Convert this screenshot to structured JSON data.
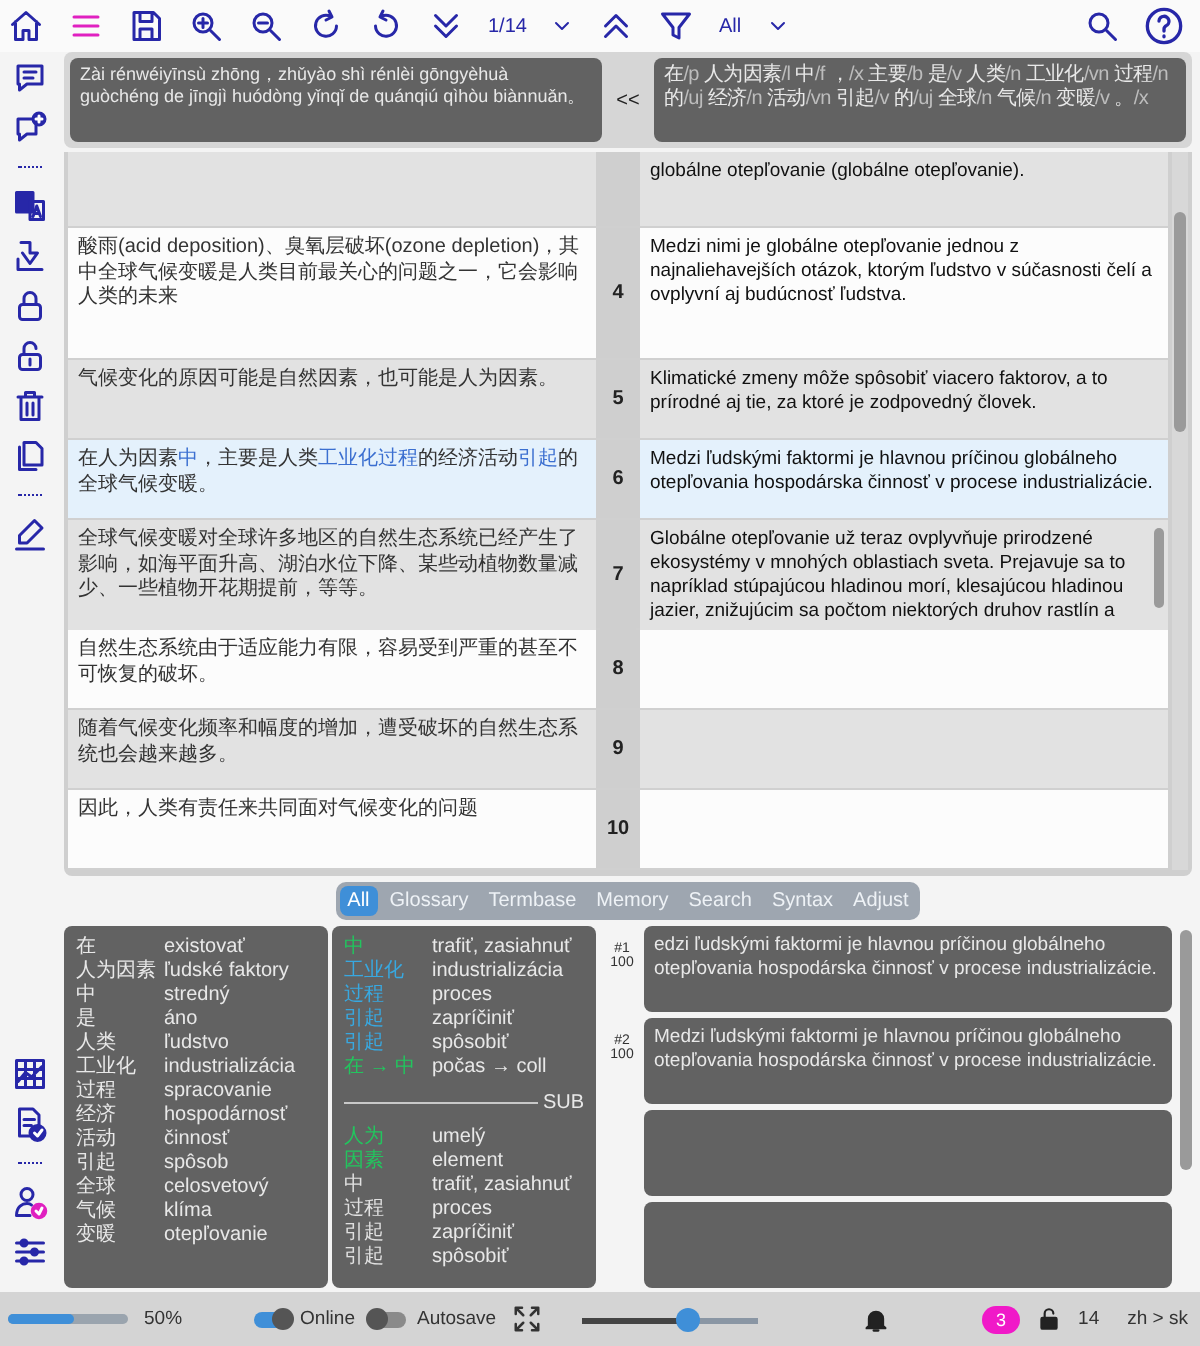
{
  "toolbar": {
    "page": "1/14",
    "filter": "All"
  },
  "pinyin": "Zài rénwéiyīnsù zhōng，zhǔyào shì rénlèi gōngyèhuà guòchéng de jīngjì huódòng yǐnqǐ de quánqiú qìhòu biànnuǎn。",
  "copy_button": "<<",
  "tagged_tokens": [
    {
      "word": "在",
      "tag": "/p"
    },
    {
      "word": "人为因素",
      "tag": "/l"
    },
    {
      "word": "中",
      "tag": "/f"
    },
    {
      "word": "，",
      "tag": "/x"
    },
    {
      "word": "主要",
      "tag": "/b"
    },
    {
      "word": "是",
      "tag": "/v"
    },
    {
      "word": "人类",
      "tag": "/n"
    },
    {
      "word": "工业化",
      "tag": "/vn"
    },
    {
      "word": "过程",
      "tag": "/n"
    },
    {
      "word": "的",
      "tag": "/uj"
    },
    {
      "word": "经济",
      "tag": "/n"
    },
    {
      "word": "活动",
      "tag": "/vn"
    },
    {
      "word": "引起",
      "tag": "/v"
    },
    {
      "word": "的",
      "tag": "/uj"
    },
    {
      "word": "全球",
      "tag": "/n"
    },
    {
      "word": "气候",
      "tag": "/n"
    },
    {
      "word": "变暖",
      "tag": "/v"
    },
    {
      "word": "。",
      "tag": "/x"
    }
  ],
  "rows": [
    {
      "target": "globálne otepľovanie (globálne otepľovanie).",
      "selected": false
    },
    {
      "number": "4",
      "source": "酸雨(acid deposition)、臭氧层破坏(ozone depletion)，其中全球气候变暖是人类目前最关心的问题之一，它会影响人类的未来",
      "target": "Medzi nimi je globálne otepľovanie jednou z najnaliehavejších otázok, ktorým ľudstvo v súčasnosti čelí a ovplyvní aj budúcnosť ľudstva.",
      "selected": false
    },
    {
      "number": "5",
      "source": "气候变化的原因可能是自然因素，也可能是人为因素。",
      "target": "Klimatické zmeny môže spôsobiť viacero faktorov, a to prírodné aj tie, za ktoré je zodpovedný človek.",
      "selected": false
    },
    {
      "number": "6",
      "source_parts": [
        {
          "text": "在人为因素",
          "highlight": false
        },
        {
          "text": "中",
          "highlight": true
        },
        {
          "text": "，主要是人类",
          "highlight": false
        },
        {
          "text": "工业化过程",
          "highlight": true
        },
        {
          "text": "的经济活动",
          "highlight": false
        },
        {
          "text": "引起",
          "highlight": true
        },
        {
          "text": "的全球气候变暖。",
          "highlight": false
        }
      ],
      "target": "Medzi ľudskými faktormi je hlavnou príčinou globálneho otepľovania hospodárska činnosť v procese industrializácie.",
      "selected": true
    },
    {
      "number": "7",
      "source": "全球气候变暖对全球许多地区的自然生态系统已经产生了影响，如海平面升高、湖泊水位下降、某些动植物数量减少、一些植物开花期提前，等等。",
      "target": "Globálne otepľovanie už teraz ovplyvňuje prirodzené ekosystémy v mnohých oblastiach sveta. Prejavuje sa to napríklad stúpajúcou hladinou morí, klesajúcou hladinou jazier, znižujúcim sa počtom niektorých druhov rastlín a",
      "selected": false
    },
    {
      "number": "8",
      "source": "自然生态系统由于适应能力有限，容易受到严重的甚至不可恢复的破坏。",
      "selected": false
    },
    {
      "number": "9",
      "source": "随着气候变化频率和幅度的增加，遭受破坏的自然生态系统也会越来越多。",
      "selected": false
    },
    {
      "number": "10",
      "source": "因此，人类有责任来共同面对气候变化的问题",
      "selected": false
    }
  ],
  "tabs": [
    {
      "label": "All",
      "selected": true
    },
    {
      "label": "Glossary",
      "selected": false
    },
    {
      "label": "Termbase",
      "selected": false
    },
    {
      "label": "Memory",
      "selected": false
    },
    {
      "label": "Search",
      "selected": false
    },
    {
      "label": "Syntax",
      "selected": false
    },
    {
      "label": "Adjust",
      "selected": false
    }
  ],
  "glossary": [
    {
      "term": "在",
      "translation": "existovať"
    },
    {
      "term": "人为因素",
      "translation": "ľudské faktory"
    },
    {
      "term": "中",
      "translation": "stredný"
    },
    {
      "term": "是",
      "translation": "áno"
    },
    {
      "term": "人类",
      "translation": "ľudstvo"
    },
    {
      "term": "工业化",
      "translation": "industrializácia"
    },
    {
      "term": "过程",
      "translation": "spracovanie"
    },
    {
      "term": "经济",
      "translation": "hospodárnosť"
    },
    {
      "term": "活动",
      "translation": "činnosť"
    },
    {
      "term": "引起",
      "translation": "spôsob"
    },
    {
      "term": "全球",
      "translation": "celosvetový"
    },
    {
      "term": "气候",
      "translation": "klíma"
    },
    {
      "term": "变暖",
      "translation": "otepľovanie"
    }
  ],
  "termbase": [
    {
      "term": "中",
      "translation": "trafiť, zasiahnuť",
      "color": "#22c55e"
    },
    {
      "term": "工业化",
      "translation": "industrializácia",
      "color": "#38a8e0"
    },
    {
      "term": "过程",
      "translation": "proces",
      "color": "#38a8e0"
    },
    {
      "term": "引起",
      "translation": "zapríčiniť",
      "color": "#38a8e0"
    },
    {
      "term": "引起",
      "translation": "spôsobiť",
      "color": "#38a8e0"
    },
    {
      "term": "在 → 中",
      "translation": "počas → coll",
      "color": "#22c55e"
    }
  ],
  "sub_label": "SUB",
  "sub_terms": [
    {
      "term": "人为",
      "translation": "umelý",
      "color": "#22c55e"
    },
    {
      "term": "因素",
      "translation": "element",
      "color": "#22c55e"
    },
    {
      "term": "中",
      "translation": "trafiť, zasiahnuť",
      "color": "#e0e0e0"
    },
    {
      "term": "过程",
      "translation": "proces",
      "color": "#e0e0e0"
    },
    {
      "term": "引起",
      "translation": "zapríčiniť",
      "color": "#e0e0e0"
    },
    {
      "term": "引起",
      "translation": "spôsobiť",
      "color": "#e0e0e0"
    }
  ],
  "matches": [
    {
      "rank": "#1",
      "score": "100",
      "text": "edzi ľudskými faktormi je hlavnou príčinou globálneho otepľovania hospodárska činnosť v procese industrializácie."
    },
    {
      "rank": "#2",
      "score": "100",
      "text": "Medzi ľudskými faktormi je hlavnou príčinou globálneho otepľovania hospodárska činnosť v procese industrializácie."
    }
  ],
  "status": {
    "progress": {
      "level": 0.55
    },
    "progress_label": "50%",
    "online": {
      "label": "Online",
      "on": true
    },
    "autosave": {
      "label": "Autosave",
      "on": false
    },
    "zoom": {
      "level": 0.6
    },
    "notifications": "3",
    "locked": "14",
    "language_pair": "zh > sk"
  }
}
